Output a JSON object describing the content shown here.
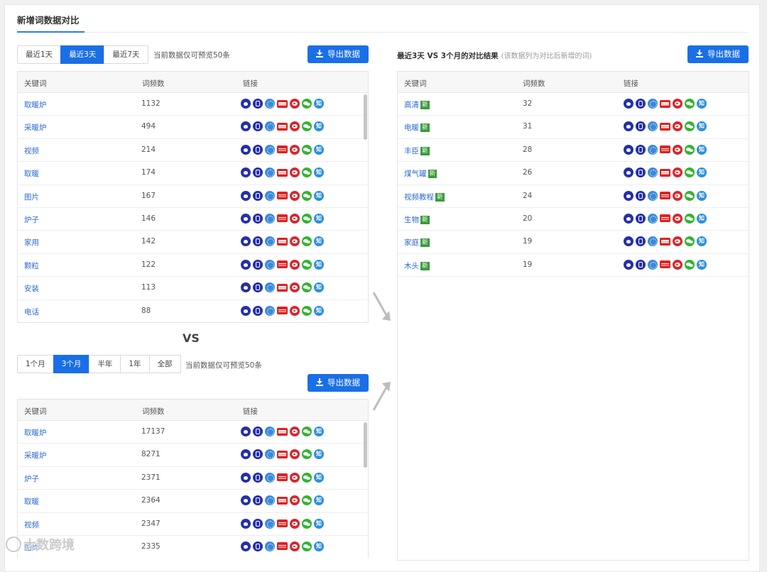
{
  "title": "新增词数据对比",
  "top": {
    "tabs": [
      "最近1天",
      "最近3天",
      "最近7天"
    ],
    "active": 1,
    "hint": "当前数据仅可预览50条",
    "export": "导出数据",
    "columns": [
      "关键词",
      "词频数",
      "链接"
    ],
    "rows": [
      {
        "kw": "取暖炉",
        "n": "1132"
      },
      {
        "kw": "采暖炉",
        "n": "494"
      },
      {
        "kw": "视频",
        "n": "214"
      },
      {
        "kw": "取暖",
        "n": "174"
      },
      {
        "kw": "图片",
        "n": "167"
      },
      {
        "kw": "炉子",
        "n": "146"
      },
      {
        "kw": "家用",
        "n": "142"
      },
      {
        "kw": "颗粒",
        "n": "122"
      },
      {
        "kw": "安装",
        "n": "113"
      },
      {
        "kw": "电话",
        "n": "88"
      }
    ]
  },
  "vs_label": "VS",
  "bottom": {
    "tabs": [
      "1个月",
      "3个月",
      "半年",
      "1年",
      "全部"
    ],
    "active": 1,
    "hint": "当前数据仅可预览50条",
    "export": "导出数据",
    "columns": [
      "关键词",
      "词频数",
      "链接"
    ],
    "rows": [
      {
        "kw": "取暖炉",
        "n": "17137"
      },
      {
        "kw": "采暖炉",
        "n": "8271"
      },
      {
        "kw": "炉子",
        "n": "2371"
      },
      {
        "kw": "取暖",
        "n": "2364"
      },
      {
        "kw": "视频",
        "n": "2347"
      },
      {
        "kw": "图片",
        "n": "2335"
      }
    ]
  },
  "result": {
    "title": "最近3天 VS 3个月的对比结果",
    "note": "(该数据列为对比后新增的词)",
    "export": "导出数据",
    "new_tag": "新",
    "columns": [
      "关键词",
      "词频数",
      "链接"
    ],
    "rows": [
      {
        "kw": "高清",
        "n": "32"
      },
      {
        "kw": "电暖",
        "n": "31"
      },
      {
        "kw": "丰臣",
        "n": "28"
      },
      {
        "kw": "煤气罐",
        "n": "26"
      },
      {
        "kw": "视频教程",
        "n": "24"
      },
      {
        "kw": "生物",
        "n": "20"
      },
      {
        "kw": "家庭",
        "n": "19"
      },
      {
        "kw": "木头",
        "n": "19"
      }
    ]
  },
  "link_icons": [
    "baidu-icon",
    "sogou-icon",
    "360-search-icon",
    "toutiao-icon",
    "weibo-icon",
    "wechat-icon",
    "zhihu-icon"
  ],
  "zhihu_glyph": "知",
  "watermark": "大数跨境",
  "colors": {
    "accent": "#1a6fe6",
    "link": "#2a6ad2",
    "new_tag": "#3a9a3a"
  }
}
